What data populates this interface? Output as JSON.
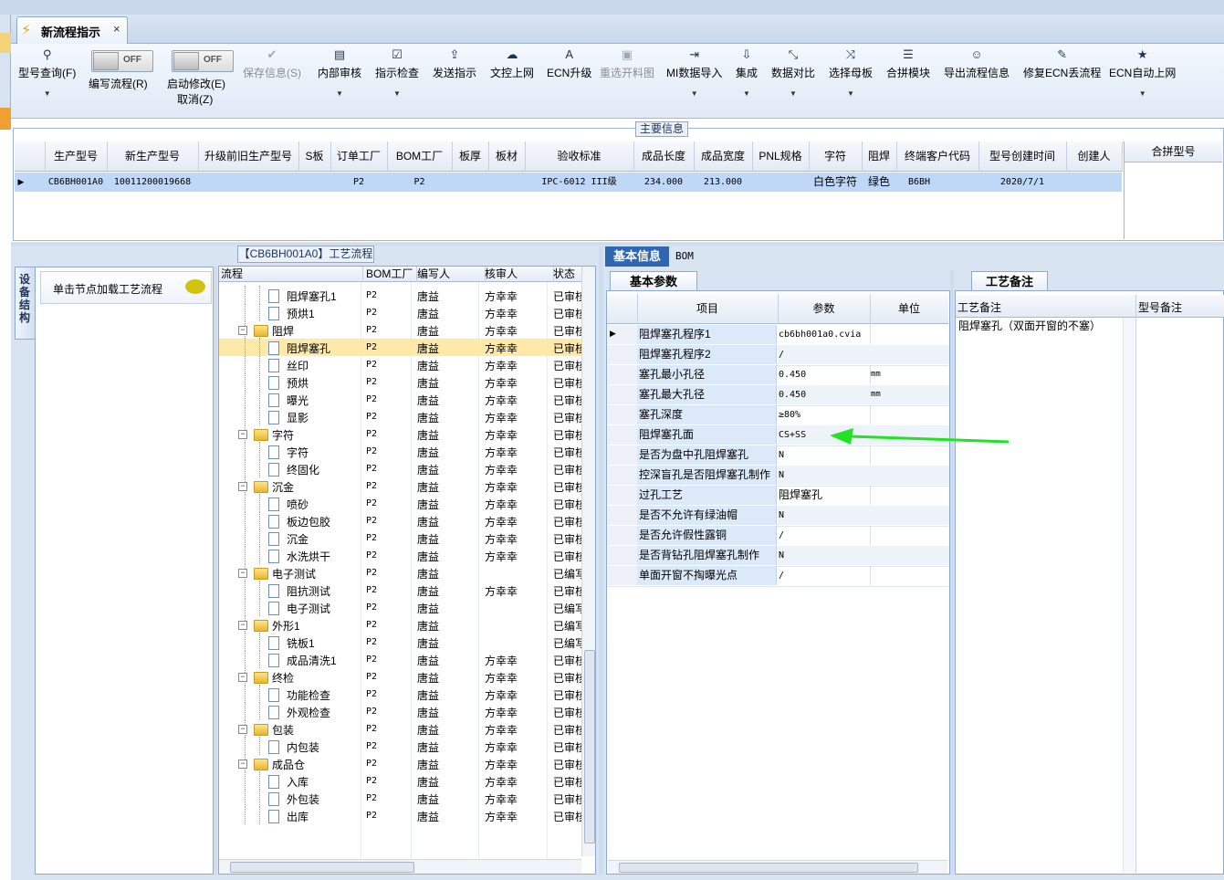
{
  "window": {
    "tab_title": "新流程指示",
    "tab_close": "×"
  },
  "toolbar": {
    "model_query": "型号查询(F)",
    "edit_flow_toggle": "OFF",
    "edit_flow_label": "编写流程(R)",
    "start_edit_toggle": "OFF",
    "start_edit_label": "启动修改(E)",
    "cancel_label": "取消(Z)",
    "save_info": "保存信息(S)",
    "internal_review": "内部审核",
    "instruction_check": "指示检查",
    "send_instruction": "发送指示",
    "doc_control_upload": "文控上网",
    "ecn_upgrade": "ECN升级",
    "reselect_material": "重选开料图",
    "mi_data_import": "MI数据导入",
    "integrate": "集成",
    "data_compare": "数据对比",
    "select_mother_board": "选择母板",
    "combine_module": "合拼模块",
    "export_flow_info": "导出流程信息",
    "fix_ecn_lost_flow": "修复ECN丢流程",
    "ecn_auto_upload": "ECN自动上网"
  },
  "main_info": {
    "caption": "主要信息",
    "columns": [
      "生产型号",
      "新生产型号",
      "升级前旧生产型号",
      "S板",
      "订单工厂",
      "BOM工厂",
      "板厚",
      "板材",
      "验收标准",
      "成品长度",
      "成品宽度",
      "PNL规格",
      "字符",
      "阻焊",
      "终端客户代码",
      "型号创建时间",
      "创建人"
    ],
    "row": [
      "CB6BH001A0",
      "10011200019668",
      "",
      "",
      "P2",
      "P2",
      "",
      "",
      "IPC-6012 III级",
      "234.000",
      "213.000",
      "",
      "白色字符",
      "绿色",
      "B6BH",
      "2020/7/1",
      ""
    ],
    "row_marker": "▶",
    "merge_model_header": "合拼型号"
  },
  "left_panel": {
    "side_tab": "设备结构",
    "load_flow_label": "单击节点加载工艺流程"
  },
  "process_tree": {
    "caption": "【CB6BH001A0】工艺流程",
    "headers": [
      "流程",
      "BOM工厂",
      "编写人",
      "核审人",
      "状态"
    ],
    "rows": [
      {
        "name": "阻焊塞孔1",
        "level": 2,
        "type": "doc",
        "bom": "P2",
        "writer": "唐益",
        "reviewer": "方幸幸",
        "status": "已审核"
      },
      {
        "name": "预烘1",
        "level": 2,
        "type": "doc",
        "bom": "P2",
        "writer": "唐益",
        "reviewer": "方幸幸",
        "status": "已审核"
      },
      {
        "name": "阻焊",
        "level": 1,
        "type": "folder",
        "bom": "P2",
        "writer": "唐益",
        "reviewer": "方幸幸",
        "status": "已审核"
      },
      {
        "name": "阻焊塞孔",
        "level": 2,
        "type": "doc",
        "bom": "P2",
        "writer": "唐益",
        "reviewer": "方幸幸",
        "status": "已审核",
        "selected": true
      },
      {
        "name": "丝印",
        "level": 2,
        "type": "doc",
        "bom": "P2",
        "writer": "唐益",
        "reviewer": "方幸幸",
        "status": "已审核"
      },
      {
        "name": "预烘",
        "level": 2,
        "type": "doc",
        "bom": "P2",
        "writer": "唐益",
        "reviewer": "方幸幸",
        "status": "已审核"
      },
      {
        "name": "曝光",
        "level": 2,
        "type": "doc",
        "bom": "P2",
        "writer": "唐益",
        "reviewer": "方幸幸",
        "status": "已审核"
      },
      {
        "name": "显影",
        "level": 2,
        "type": "doc",
        "bom": "P2",
        "writer": "唐益",
        "reviewer": "方幸幸",
        "status": "已审核"
      },
      {
        "name": "字符",
        "level": 1,
        "type": "folder",
        "bom": "P2",
        "writer": "唐益",
        "reviewer": "方幸幸",
        "status": "已审核"
      },
      {
        "name": "字符",
        "level": 2,
        "type": "doc",
        "bom": "P2",
        "writer": "唐益",
        "reviewer": "方幸幸",
        "status": "已审核"
      },
      {
        "name": "终固化",
        "level": 2,
        "type": "doc",
        "bom": "P2",
        "writer": "唐益",
        "reviewer": "方幸幸",
        "status": "已审核"
      },
      {
        "name": "沉金",
        "level": 1,
        "type": "folder",
        "bom": "P2",
        "writer": "唐益",
        "reviewer": "方幸幸",
        "status": "已审核"
      },
      {
        "name": "喷砂",
        "level": 2,
        "type": "doc",
        "bom": "P2",
        "writer": "唐益",
        "reviewer": "方幸幸",
        "status": "已审核"
      },
      {
        "name": "板边包胶",
        "level": 2,
        "type": "doc",
        "bom": "P2",
        "writer": "唐益",
        "reviewer": "方幸幸",
        "status": "已审核"
      },
      {
        "name": "沉金",
        "level": 2,
        "type": "doc",
        "bom": "P2",
        "writer": "唐益",
        "reviewer": "方幸幸",
        "status": "已审核"
      },
      {
        "name": "水洗烘干",
        "level": 2,
        "type": "doc",
        "bom": "P2",
        "writer": "唐益",
        "reviewer": "方幸幸",
        "status": "已审核"
      },
      {
        "name": "电子测试",
        "level": 1,
        "type": "folder",
        "bom": "P2",
        "writer": "唐益",
        "reviewer": "",
        "status": "已编写"
      },
      {
        "name": "阻抗测试",
        "level": 2,
        "type": "doc",
        "bom": "P2",
        "writer": "唐益",
        "reviewer": "方幸幸",
        "status": "已审核"
      },
      {
        "name": "电子测试",
        "level": 2,
        "type": "doc",
        "bom": "P2",
        "writer": "唐益",
        "reviewer": "",
        "status": "已编写"
      },
      {
        "name": "外形1",
        "level": 1,
        "type": "folder",
        "bom": "P2",
        "writer": "唐益",
        "reviewer": "",
        "status": "已编写"
      },
      {
        "name": "铣板1",
        "level": 2,
        "type": "doc",
        "bom": "P2",
        "writer": "唐益",
        "reviewer": "",
        "status": "已编写"
      },
      {
        "name": "成品清洗1",
        "level": 2,
        "type": "doc",
        "bom": "P2",
        "writer": "唐益",
        "reviewer": "方幸幸",
        "status": "已审核"
      },
      {
        "name": "终检",
        "level": 1,
        "type": "folder",
        "bom": "P2",
        "writer": "唐益",
        "reviewer": "方幸幸",
        "status": "已审核"
      },
      {
        "name": "功能检查",
        "level": 2,
        "type": "doc",
        "bom": "P2",
        "writer": "唐益",
        "reviewer": "方幸幸",
        "status": "已审核"
      },
      {
        "name": "外观检查",
        "level": 2,
        "type": "doc",
        "bom": "P2",
        "writer": "唐益",
        "reviewer": "方幸幸",
        "status": "已审核"
      },
      {
        "name": "包装",
        "level": 1,
        "type": "folder",
        "bom": "P2",
        "writer": "唐益",
        "reviewer": "方幸幸",
        "status": "已审核"
      },
      {
        "name": "内包装",
        "level": 2,
        "type": "doc",
        "bom": "P2",
        "writer": "唐益",
        "reviewer": "方幸幸",
        "status": "已审核"
      },
      {
        "name": "成品仓",
        "level": 1,
        "type": "folder",
        "bom": "P2",
        "writer": "唐益",
        "reviewer": "方幸幸",
        "status": "已审核"
      },
      {
        "name": "入库",
        "level": 2,
        "type": "doc",
        "bom": "P2",
        "writer": "唐益",
        "reviewer": "方幸幸",
        "status": "已审核"
      },
      {
        "name": "外包装",
        "level": 2,
        "type": "doc",
        "bom": "P2",
        "writer": "唐益",
        "reviewer": "方幸幸",
        "status": "已审核"
      },
      {
        "name": "出库",
        "level": 2,
        "type": "doc",
        "bom": "P2",
        "writer": "唐益",
        "reviewer": "方幸幸",
        "status": "已审核"
      }
    ]
  },
  "basic_info": {
    "tab_basic": "基本信息",
    "tab_bom": "BOM",
    "params_tab": "基本参数",
    "headers": [
      "项目",
      "参数",
      "单位"
    ],
    "rows": [
      {
        "item": "阻焊塞孔程序1",
        "value": "cb6bh001a0.cvia",
        "unit": ""
      },
      {
        "item": "阻焊塞孔程序2",
        "value": "/",
        "unit": ""
      },
      {
        "item": "塞孔最小孔径",
        "value": "0.450",
        "unit": "mm"
      },
      {
        "item": "塞孔最大孔径",
        "value": "0.450",
        "unit": "mm"
      },
      {
        "item": "塞孔深度",
        "value": "≥80%",
        "unit": ""
      },
      {
        "item": "阻焊塞孔面",
        "value": "CS+SS",
        "unit": ""
      },
      {
        "item": "是否为盘中孔阻焊塞孔",
        "value": "N",
        "unit": ""
      },
      {
        "item": "控深盲孔是否阻焊塞孔制作",
        "value": "N",
        "unit": ""
      },
      {
        "item": "过孔工艺",
        "value": "阻焊塞孔",
        "unit": ""
      },
      {
        "item": "是否不允许有绿油帽",
        "value": "N",
        "unit": ""
      },
      {
        "item": "是否允许假性露铜",
        "value": "/",
        "unit": ""
      },
      {
        "item": "是否背钻孔阻焊塞孔制作",
        "value": "N",
        "unit": ""
      },
      {
        "item": "单面开窗不掏曝光点",
        "value": "/",
        "unit": ""
      }
    ],
    "row_marker": "▶"
  },
  "process_notes": {
    "tab": "工艺备注",
    "col1": "工艺备注",
    "col2": "型号备注",
    "text": "阻焊塞孔（双面开窗的不塞）"
  },
  "colors": {
    "accent": "#2f65b1",
    "selected_row": "#bfd8f7",
    "selected_tree_row": "#ffe9a8",
    "arrow": "#22e322"
  }
}
